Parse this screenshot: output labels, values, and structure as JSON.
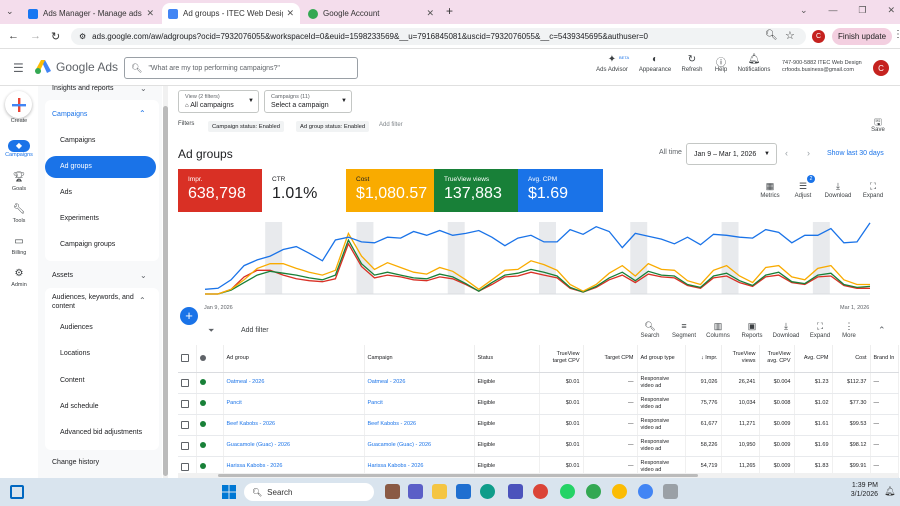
{
  "browser": {
    "tabs": [
      {
        "title": "Ads Manager - Manage ads - Ads",
        "color": "#1877f2"
      },
      {
        "title": "Ad groups - ITEC Web Design & D",
        "color": "#4285f4"
      },
      {
        "title": "Google Account",
        "color": "#34a853"
      }
    ],
    "new_tab": "+",
    "url": "ads.google.com/aw/adgroups?ocid=7932076055&workspaceId=0&euid=1598233569&__u=7916845081&uscid=7932076055&__c=5439345695&authuser=0",
    "profile_letter": "C",
    "finish_update": "Finish update",
    "window_controls": [
      "⌄",
      "—",
      "❐",
      "✕"
    ]
  },
  "ads_header": {
    "logo_text": "Google Ads",
    "search_placeholder": "\"What are my top performing campaigns?\"",
    "actions": [
      "Ads Advisor",
      "Appearance",
      "Refresh",
      "Help",
      "Notifications"
    ],
    "beta": "BETA",
    "account_line1": "747-900-5882 ITEC Web Design",
    "account_line2": "crfoods.business@gmail.com",
    "avatar_letter": "C"
  },
  "rail": {
    "create": "Create",
    "items": [
      "Campaigns",
      "Goals",
      "Tools",
      "Billing",
      "Admin"
    ]
  },
  "nav": {
    "insights": "Insights and reports",
    "campaigns_header": "Campaigns",
    "campaign_items": [
      "Campaigns",
      "Ad groups",
      "Ads",
      "Experiments",
      "Campaign groups"
    ],
    "assets": "Assets",
    "audiences_header": "Audiences, keywords, and content",
    "audience_items": [
      "Audiences",
      "Locations",
      "Content",
      "Ad schedule",
      "Advanced bid adjustments"
    ],
    "change_history": "Change history"
  },
  "filters": {
    "view_label": "View (2 filters)",
    "view_value": "All campaigns",
    "campaigns_label": "Campaigns (11)",
    "campaigns_value": "Select a campaign",
    "filters_label": "Filters",
    "chips": [
      "Campaign status: Enabled",
      "Ad group status: Enabled"
    ],
    "add_filter": "Add filter",
    "save": "Save"
  },
  "page": {
    "title": "Ad groups",
    "all_time": "All time",
    "date_range": "Jan 9 – Mar 1, 2026",
    "show_last": "Show last 30 days"
  },
  "scorecards": [
    {
      "label": "Impr.",
      "value": "638,798",
      "color": "#d93025"
    },
    {
      "label": "CTR",
      "value": "1.01%",
      "color": "#ffffff"
    },
    {
      "label": "Cost",
      "value": "$1,080.57",
      "color": "#f9ab00"
    },
    {
      "label": "TrueView views",
      "value": "137,883",
      "color": "#188038"
    },
    {
      "label": "Avg. CPM",
      "value": "$1.69",
      "color": "#1a73e8"
    }
  ],
  "chart_tools": [
    "Metrics",
    "Adjust",
    "Download",
    "Expand"
  ],
  "adjust_badge": "2",
  "chart_data": {
    "type": "line",
    "x_start": "Jan 9, 2026",
    "x_end": "Mar 1, 2026",
    "points": 52,
    "series": [
      {
        "color": "#1a73e8",
        "values": [
          0.5,
          0.6,
          1.5,
          3.0,
          3.6,
          4.0,
          4.7,
          5.0,
          4.3,
          3.5,
          5.7,
          6.0,
          5.5,
          5.4,
          6.0,
          5.9,
          6.6,
          6.2,
          6.7,
          6.2,
          6.4,
          6.7,
          6.0,
          5.1,
          5.9,
          6.2,
          5.5,
          5.5,
          6.8,
          6.3,
          7.1,
          6.6,
          4.9,
          6.4,
          6.1,
          5.8,
          5.3,
          6.0,
          5.2,
          6.3,
          6.2,
          6.0,
          5.9,
          6.8,
          6.5,
          5.4,
          6.2,
          6.2,
          6.9,
          5.4,
          5.5,
          7.5
        ]
      },
      {
        "color": "#f9ab00",
        "values": [
          0,
          0,
          0.5,
          1.5,
          2.7,
          3.2,
          3.2,
          2.7,
          2.3,
          2.0,
          2.5,
          6.4,
          4.0,
          2.6,
          3.3,
          2.8,
          2.3,
          2.1,
          2.8,
          2.4,
          1.5,
          0.5,
          1.5,
          2.5,
          2.6,
          3.5,
          3.1,
          2.5,
          1.0,
          0.3,
          1.0,
          2.2,
          3.0,
          1.9,
          3.2,
          2.6,
          2.5,
          1.4,
          1.0,
          2.5,
          3.0,
          1.9,
          1.2,
          2.8,
          3.0,
          1.8,
          1.5,
          2.7,
          3.0,
          1.5,
          1.0,
          1.0
        ]
      },
      {
        "color": "#188038",
        "values": [
          0,
          0,
          0.4,
          1.2,
          2.0,
          2.4,
          2.2,
          2.0,
          1.7,
          1.5,
          2.0,
          5.7,
          3.2,
          2.0,
          2.3,
          2.0,
          1.7,
          1.6,
          2.1,
          1.8,
          1.1,
          0.3,
          1.2,
          2.0,
          2.2,
          2.6,
          2.3,
          1.9,
          0.7,
          0.2,
          0.8,
          1.7,
          2.3,
          1.4,
          2.4,
          2.0,
          1.9,
          1.0,
          0.7,
          1.9,
          2.2,
          1.4,
          0.9,
          2.0,
          2.3,
          1.3,
          1.1,
          2.0,
          2.2,
          1.0,
          0.7,
          0.8
        ]
      },
      {
        "color": "#d93025",
        "values": [
          0,
          0,
          0.5,
          1.8,
          2.5,
          2.5,
          2.0,
          1.6,
          1.4,
          1.3,
          1.6,
          5.3,
          2.9,
          1.7,
          2.0,
          1.8,
          1.5,
          1.4,
          1.8,
          1.6,
          1.0,
          0.3,
          1.0,
          1.8,
          1.9,
          2.3,
          2.0,
          1.7,
          0.6,
          0.2,
          0.7,
          1.5,
          2.0,
          1.2,
          2.1,
          1.8,
          1.7,
          0.9,
          0.6,
          1.7,
          1.9,
          1.2,
          0.8,
          1.8,
          2.0,
          1.2,
          1.0,
          1.8,
          1.9,
          0.9,
          0.6,
          0.6
        ]
      }
    ]
  },
  "table_tools": [
    "Search",
    "Segment",
    "Columns",
    "Reports",
    "Download",
    "Expand",
    "More"
  ],
  "table_add_filter": "Add filter",
  "table": {
    "headers": [
      "Ad group",
      "Campaign",
      "Status",
      "TrueView target CPV",
      "Target CPM",
      "Ad group type",
      "↓ Impr.",
      "TrueView views",
      "TrueView avg. CPV",
      "Avg. CPM",
      "Cost",
      "Brand In"
    ],
    "rows": [
      [
        "Oatmeal - 2026",
        "Oatmeal - 2026",
        "Eligible",
        "$0.01",
        "—",
        "Responsive video ad",
        "91,026",
        "26,241",
        "$0.004",
        "$1.23",
        "$112.37",
        "—"
      ],
      [
        "Pancit",
        "Pancit",
        "Eligible",
        "$0.01",
        "—",
        "Responsive video ad",
        "75,776",
        "10,034",
        "$0.008",
        "$1.02",
        "$77.30",
        "—"
      ],
      [
        "Beef Kabobs - 2026",
        "Beef Kabobs - 2026",
        "Eligible",
        "$0.01",
        "—",
        "Responsive video ad",
        "61,677",
        "11,271",
        "$0.009",
        "$1.61",
        "$99.53",
        "—"
      ],
      [
        "Guacamole (Guac) - 2026",
        "Guacamole (Guac) - 2026",
        "Eligible",
        "$0.01",
        "—",
        "Responsive video ad",
        "58,226",
        "10,950",
        "$0.009",
        "$1.69",
        "$98.12",
        "—"
      ],
      [
        "Harissa Kabobs - 2026",
        "Harissa Kabobs - 2026",
        "Eligible",
        "$0.01",
        "—",
        "Responsive video ad",
        "54,719",
        "11,265",
        "$0.009",
        "$1.83",
        "$99.91",
        "—"
      ]
    ]
  },
  "taskbar": {
    "search": "Search",
    "time": "1:39 PM",
    "date": "3/1/2026"
  }
}
